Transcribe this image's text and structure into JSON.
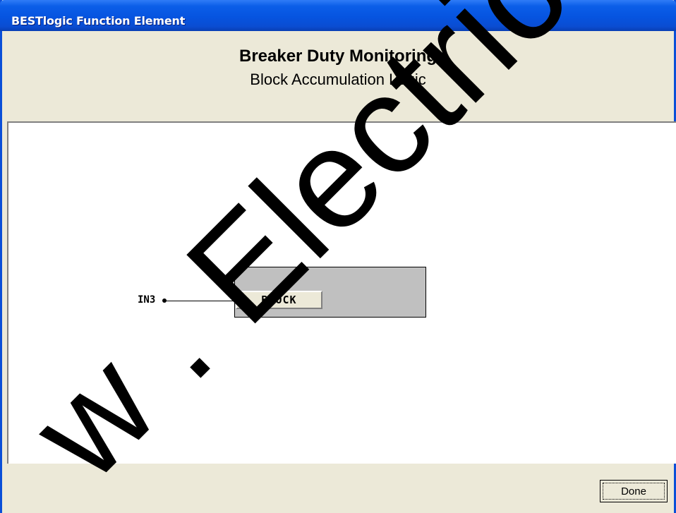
{
  "window": {
    "title": "BESTlogic Function Element"
  },
  "header": {
    "title": "Breaker Duty Monitoring",
    "subtitle": "Block Accumulation Logic"
  },
  "diagram": {
    "block_input_label": "BLOCK",
    "input_signal": "IN3"
  },
  "footer": {
    "done_label": "Done"
  },
  "watermark": {
    "text": "w . Electrical",
    "color": "#000000"
  }
}
